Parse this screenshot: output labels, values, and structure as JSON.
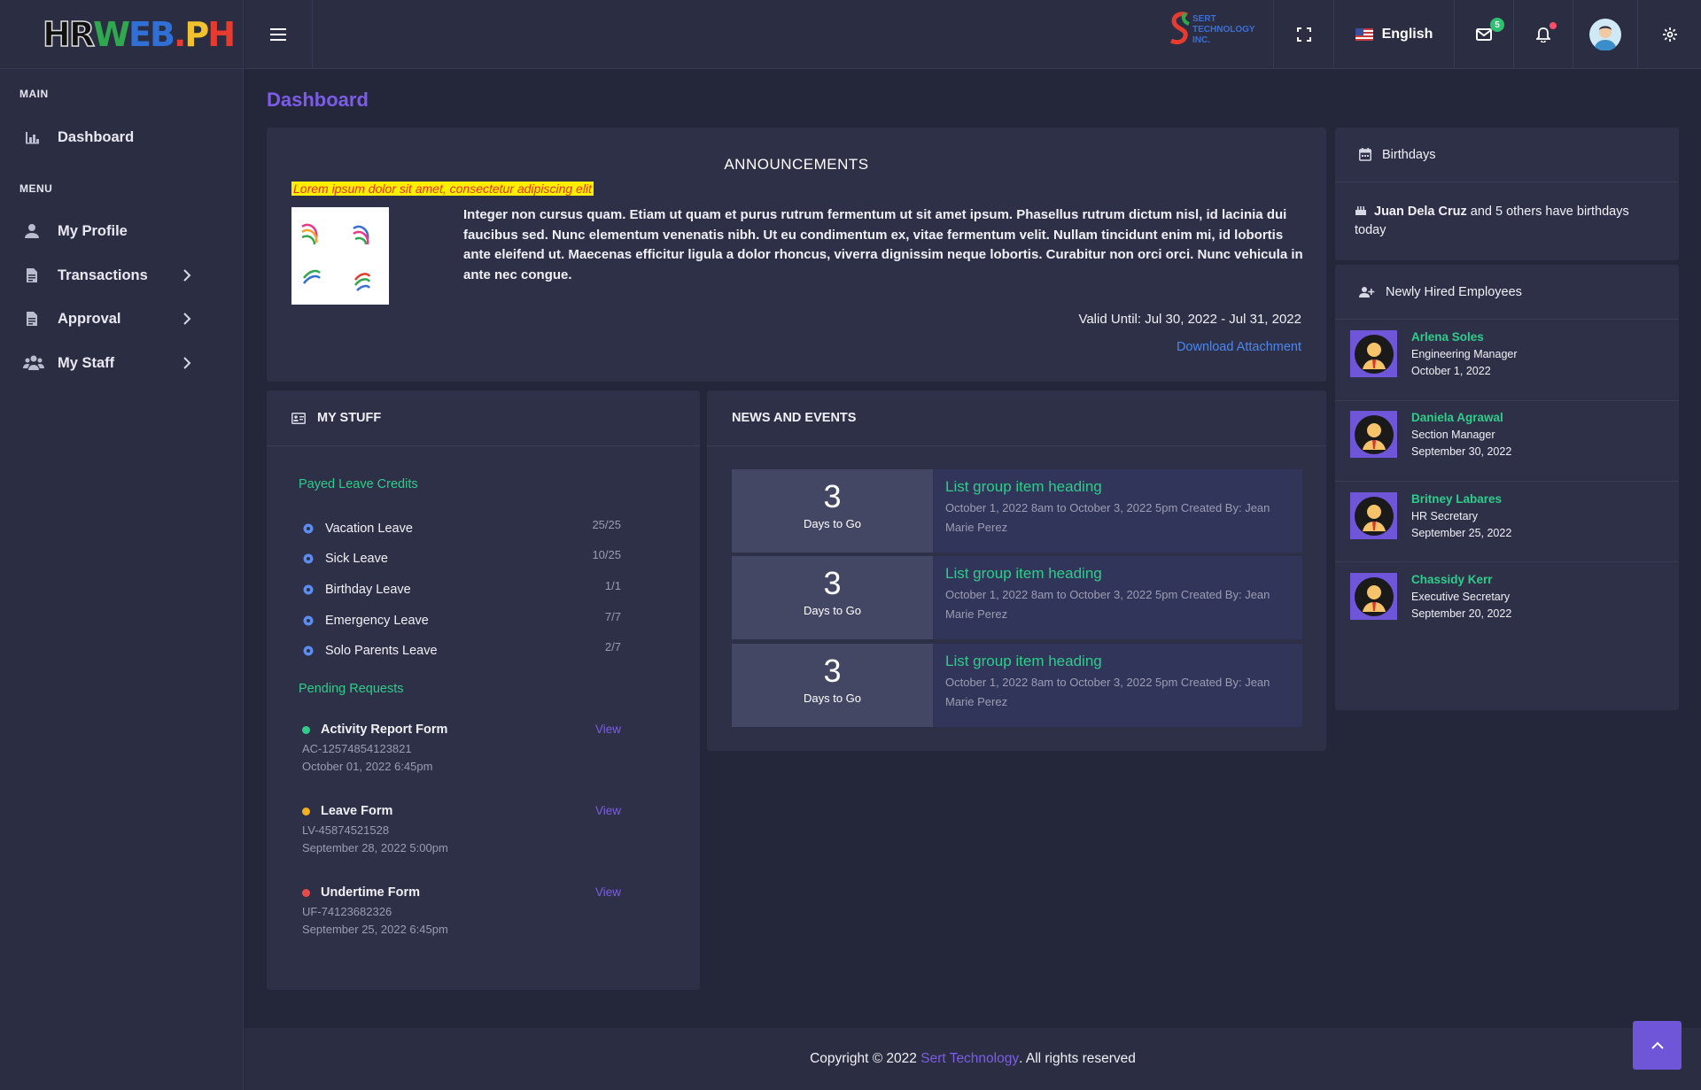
{
  "brand": {
    "logo_text": "HRWEB.PH",
    "company_logo_text": "SERT TECHNOLOGY INC."
  },
  "sidebar": {
    "main_label": "MAIN",
    "menu_label": "MENU",
    "items": [
      {
        "label": "Dashboard",
        "icon": "bar-chart-icon"
      },
      {
        "label": "My Profile",
        "icon": "user-icon"
      },
      {
        "label": "Transactions",
        "icon": "document-icon"
      },
      {
        "label": "Approval",
        "icon": "document-icon"
      },
      {
        "label": "My Staff",
        "icon": "users-icon"
      }
    ]
  },
  "topbar": {
    "language": "English",
    "mail_count": "5"
  },
  "page": {
    "title": "Dashboard"
  },
  "announcements": {
    "title": "ANNOUNCEMENTS",
    "highlight": "Lorem ipsum dolor sit amet, consectetur adipiscing elit",
    "body": "Integer non cursus quam. Etiam ut quam et purus rutrum fermentum ut sit amet ipsum. Phasellus rutrum dictum nisl, id lacinia dui faucibus sed. Nunc elementum venenatis nibh. Ut eu condimentum ex, vitae fermentum velit. Nullam tincidunt enim mi, id lobortis ante eleifend ut. Maecenas efficitur ligula a dolor rhoncus, viverra dignissim neque lobortis. Curabitur non orci orci. Nunc vehicula in ante nec congue.",
    "valid_until": "Valid Until: Jul 30, 2022 - Jul 31, 2022",
    "download": "Download Attachment"
  },
  "my_stuff": {
    "title": "MY STUFF",
    "leave_heading": "Payed Leave Credits",
    "leaves": [
      {
        "label": "Vacation Leave",
        "value": "25/25"
      },
      {
        "label": "Sick Leave",
        "value": "10/25"
      },
      {
        "label": "Birthday Leave",
        "value": "1/1"
      },
      {
        "label": "Emergency Leave",
        "value": "7/7"
      },
      {
        "label": "Solo Parents Leave",
        "value": "2/7"
      }
    ],
    "pending_heading": "Pending Requests",
    "requests": [
      {
        "title": "Activity Report Form",
        "code": "AC-12574854123821",
        "date": "October 01, 2022 6:45pm",
        "view": "View",
        "status_color": "#2fcc8b"
      },
      {
        "title": "Leave Form",
        "code": "LV-45874521528",
        "date": "September 28, 2022 5:00pm",
        "view": "View",
        "status_color": "#f2b01e"
      },
      {
        "title": "Undertime Form",
        "code": "UF-74123682326",
        "date": "September 25, 2022 6:45pm",
        "view": "View",
        "status_color": "#e84a4a"
      }
    ]
  },
  "news": {
    "title": "NEWS AND EVENTS",
    "items": [
      {
        "count": "3",
        "count_label": "Days to Go",
        "heading": "List group item heading",
        "detail": "October 1, 2022 8am to October 3, 2022 5pm Created By: Jean Marie Perez"
      },
      {
        "count": "3",
        "count_label": "Days to Go",
        "heading": "List group item heading",
        "detail": "October 1, 2022 8am to October 3, 2022 5pm Created By: Jean Marie Perez"
      },
      {
        "count": "3",
        "count_label": "Days to Go",
        "heading": "List group item heading",
        "detail": "October 1, 2022 8am to October 3, 2022 5pm Created By: Jean Marie Perez"
      }
    ]
  },
  "birthdays": {
    "title": "Birthdays",
    "name": "Juan Dela Cruz",
    "rest": " and 5 others have birthdays today"
  },
  "new_hires": {
    "title": "Newly Hired Employees",
    "employees": [
      {
        "name": "Arlena Soles",
        "role": "Engineering Manager",
        "date": "October 1, 2022"
      },
      {
        "name": "Daniela Agrawal",
        "role": "Section Manager",
        "date": "September 30, 2022"
      },
      {
        "name": "Britney Labares",
        "role": "HR Secretary",
        "date": "September 25, 2022"
      },
      {
        "name": "Chassidy Kerr",
        "role": "Executive Secretary",
        "date": "September 20, 2022"
      }
    ]
  },
  "footer": {
    "prefix": "Copyright © 2022 ",
    "link": "Sert Technology",
    "suffix": ". All rights reserved"
  },
  "colors": {
    "accent": "#7c5ce8",
    "green": "#2fcc8b",
    "link_blue": "#4a88f0"
  }
}
